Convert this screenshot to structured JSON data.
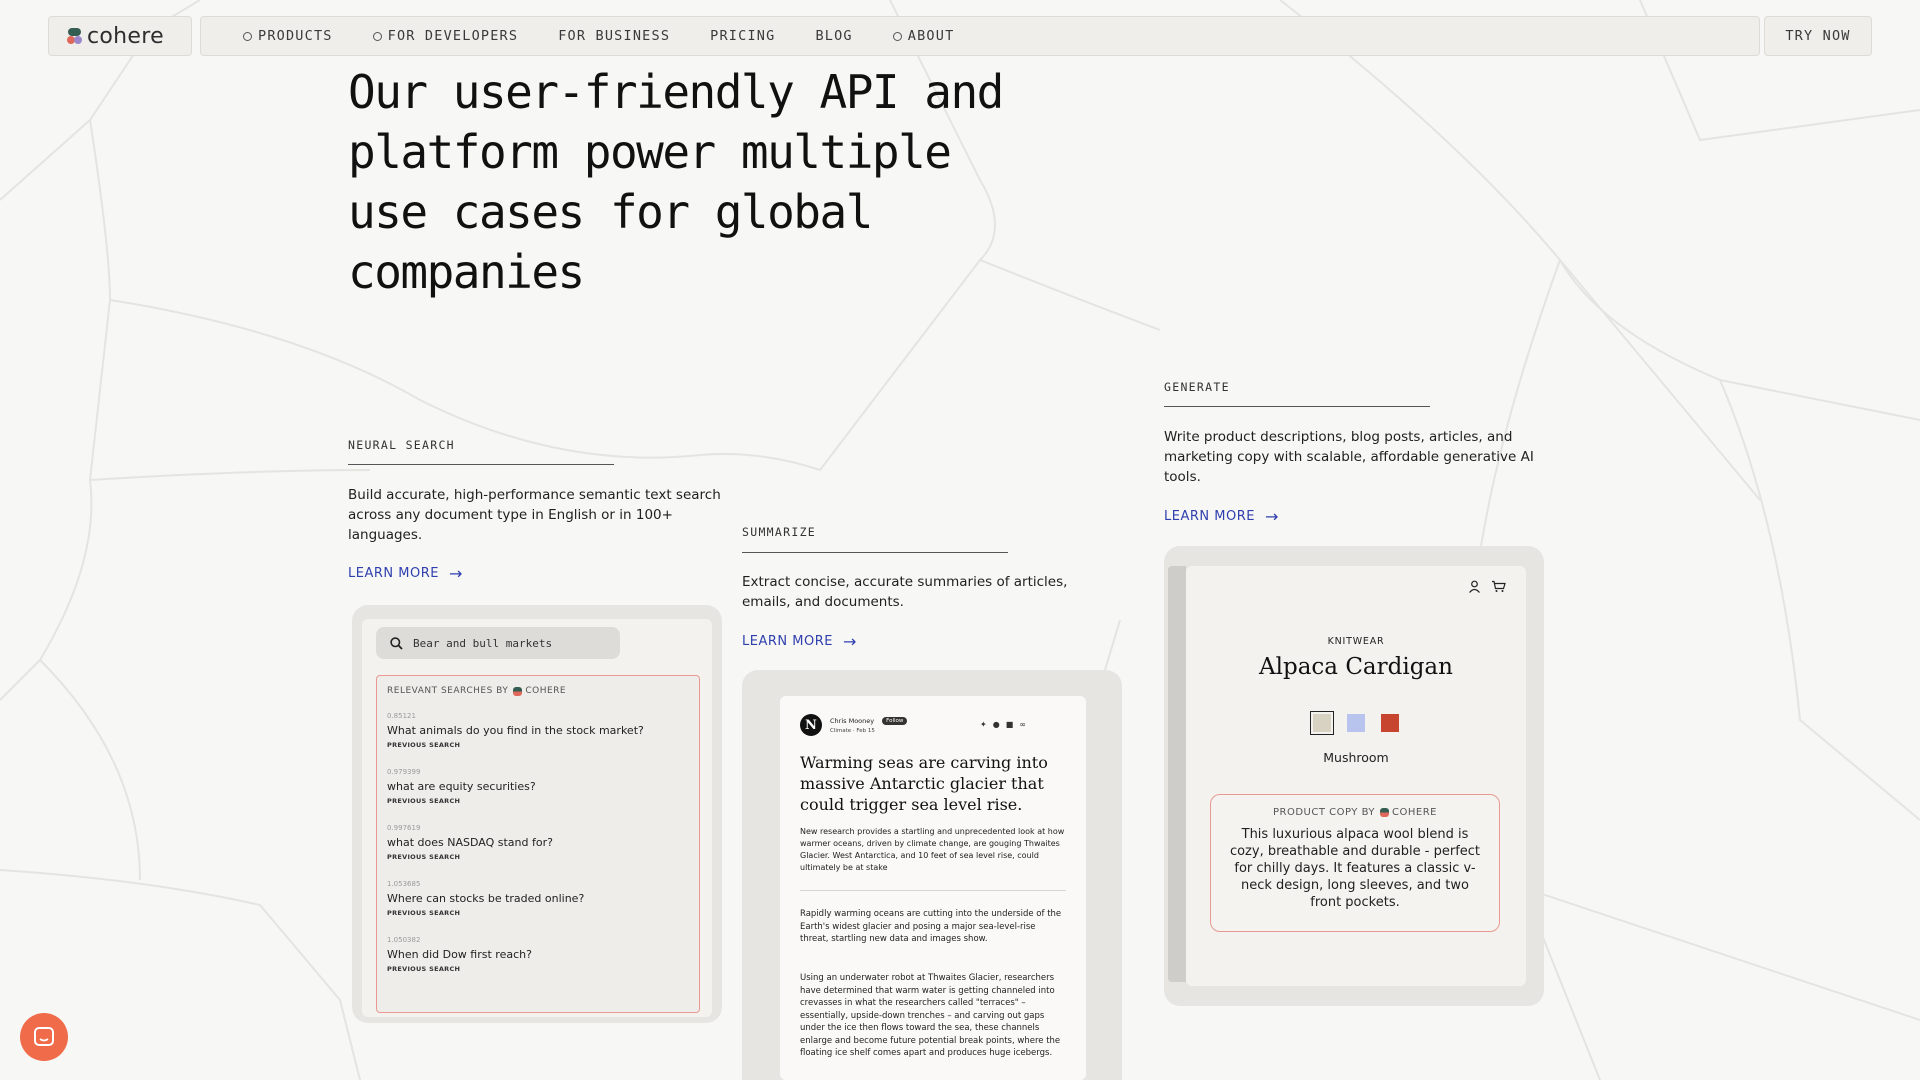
{
  "brand": {
    "logo_text": "cohere"
  },
  "nav": {
    "items": [
      {
        "label": "PRODUCTS",
        "has_dot": true
      },
      {
        "label": "FOR DEVELOPERS",
        "has_dot": true
      },
      {
        "label": "FOR BUSINESS",
        "has_dot": false
      },
      {
        "label": "PRICING",
        "has_dot": false
      },
      {
        "label": "BLOG",
        "has_dot": false
      },
      {
        "label": "ABOUT",
        "has_dot": true
      }
    ],
    "cta": "TRY NOW"
  },
  "hero": {
    "lines": [
      "Our user-friendly API and",
      "platform power multiple",
      "use cases for global",
      "companies"
    ]
  },
  "sections": {
    "search": {
      "label": "NEURAL SEARCH",
      "text": "Build accurate, high-performance semantic text search across any document type in English or in 100+ languages.",
      "link": "LEARN MORE"
    },
    "summarize": {
      "label": "SUMMARIZE",
      "text": "Extract concise, accurate summaries of articles, emails, and documents.",
      "link": "LEARN MORE"
    },
    "generate": {
      "label": "GENERATE",
      "text": "Write product descriptions, blog posts, articles, and marketing copy with scalable, affordable generative AI tools.",
      "link": "LEARN MORE"
    }
  },
  "search_card": {
    "query": "Bear and bull markets",
    "header": "RELEVANT SEARCHES BY",
    "header_brand": "COHERE",
    "results": [
      {
        "score": "0.85121",
        "question": "What animals do you find in the stock market?",
        "sub": "PREVIOUS SEARCH"
      },
      {
        "score": "0.979399",
        "question": "what are equity securities?",
        "sub": "PREVIOUS SEARCH"
      },
      {
        "score": "0.997619",
        "question": "what does NASDAQ stand for?",
        "sub": "PREVIOUS SEARCH"
      },
      {
        "score": "1.053685",
        "question": "Where can stocks be traded online?",
        "sub": "PREVIOUS SEARCH"
      },
      {
        "score": "1.050382",
        "question": "When did Dow first reach?",
        "sub": "PREVIOUS SEARCH"
      }
    ]
  },
  "article_card": {
    "author": "Chris Mooney",
    "follow": "Follow",
    "meta": "Climate · Feb 15",
    "title": "Warming seas are carving into massive Antarctic glacier that could trigger sea level rise.",
    "summary": "New research provides a startling and unprecedented look at how warmer oceans, driven by climate change, are gouging Thwaites Glacier. West Antarctica, and 10 feet of sea level rise, could ultimately be at stake",
    "para1": "Rapidly warming oceans are cutting into the underside of the Earth's widest glacier and posing a major sea-level-rise threat, startling new data and images show.",
    "para2": "Using an underwater robot at Thwaites Glacier, researchers have determined that warm water is getting channeled into crevasses in what the researchers called \"terraces\" – essentially, upside-down trenches – and carving out gaps under the ice then flows toward the sea, these channels enlarge and become future potential break points, where the floating ice shelf comes apart and produces huge icebergs."
  },
  "product_card": {
    "category": "KNITWEAR",
    "title": "Alpaca Cardigan",
    "swatches": [
      "#d8d2c2",
      "#b9c4ee",
      "#c7452e"
    ],
    "selected_color": "Mushroom",
    "copy_header": "PRODUCT COPY BY",
    "copy_brand": "COHERE",
    "copy_text": "This luxurious alpaca wool blend is cozy, breathable and durable - perfect for chilly days. It features a classic v-neck design, long sleeves, and two front pockets."
  },
  "colors": {
    "accent_link": "#2f3fae",
    "highlight_border": "#e89a90",
    "chat_button": "#ef6b4a"
  }
}
